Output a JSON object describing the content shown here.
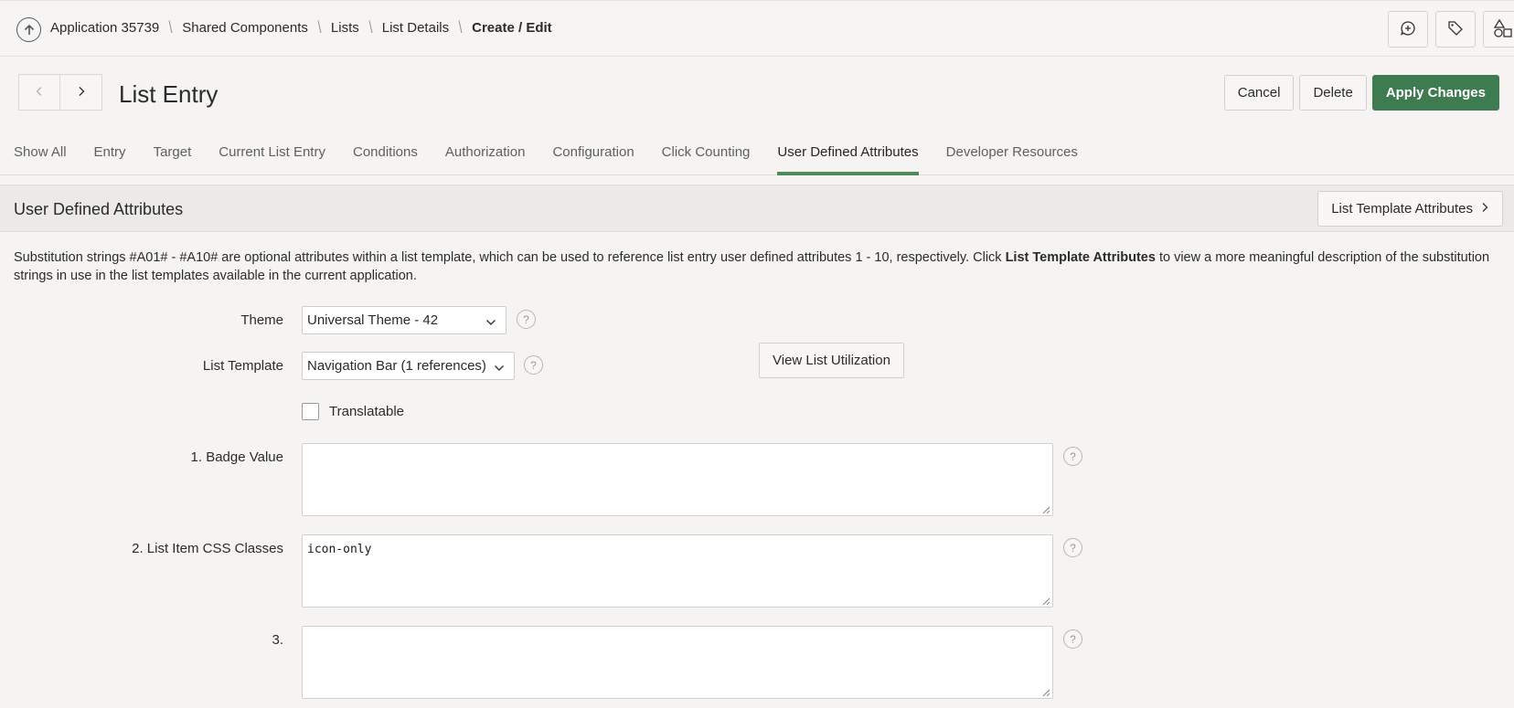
{
  "breadcrumb": {
    "items": [
      "Application 35739",
      "Shared Components",
      "Lists",
      "List Details"
    ],
    "current": "Create / Edit",
    "separator": "\\"
  },
  "top_actions": {
    "icons": [
      "feedback-icon",
      "tag-icon",
      "shapes-icon"
    ]
  },
  "page": {
    "title": "List Entry"
  },
  "actions": {
    "cancel": "Cancel",
    "delete": "Delete",
    "apply": "Apply Changes"
  },
  "tabs": [
    {
      "label": "Show All",
      "active": false
    },
    {
      "label": "Entry",
      "active": false
    },
    {
      "label": "Target",
      "active": false
    },
    {
      "label": "Current List Entry",
      "active": false
    },
    {
      "label": "Conditions",
      "active": false
    },
    {
      "label": "Authorization",
      "active": false
    },
    {
      "label": "Configuration",
      "active": false
    },
    {
      "label": "Click Counting",
      "active": false
    },
    {
      "label": "User Defined Attributes",
      "active": true
    },
    {
      "label": "Developer Resources",
      "active": false
    }
  ],
  "region": {
    "title": "User Defined Attributes",
    "template_attributes_button": "List Template Attributes",
    "description_part1": "Substitution strings #A01# - #A10# are optional attributes within a list template, which can be used to reference list entry user defined attributes 1 - 10, respectively. Click ",
    "description_bold": "List Template Attributes",
    "description_part2": " to view a more meaningful description of the substitution strings in use in the list templates available in the current application."
  },
  "form": {
    "theme_label": "Theme",
    "theme_value": "Universal Theme - 42",
    "list_template_label": "List Template",
    "list_template_value": "Navigation Bar (1 references)",
    "view_utilization": "View List Utilization",
    "translatable_label": "Translatable",
    "translatable_checked": false,
    "attr1_label": "1. Badge Value",
    "attr1_value": "",
    "attr2_label": "2. List Item CSS Classes",
    "attr2_value": "icon-only",
    "attr3_label": "3.",
    "attr3_value": "",
    "help_glyph": "?"
  },
  "colors": {
    "primary": "#3e7b50",
    "active_tab": "#4f8a5a",
    "background": "#f5f4f2"
  }
}
